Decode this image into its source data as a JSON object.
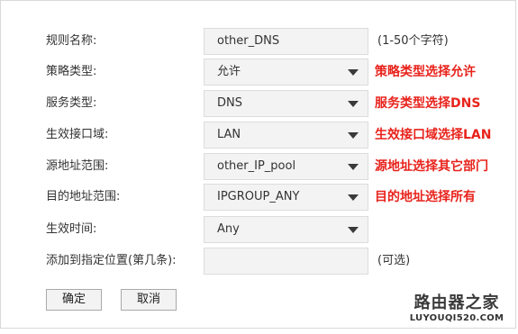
{
  "form": {
    "rows": [
      {
        "label": "规则名称:",
        "value": "other_DNS",
        "hint": "(1-50个字符)",
        "note": ""
      },
      {
        "label": "策略类型:",
        "value": "允许",
        "hint": "",
        "note": "策略类型选择允许"
      },
      {
        "label": "服务类型:",
        "value": "DNS",
        "hint": "",
        "note": "服务类型选择DNS"
      },
      {
        "label": "生效接口域:",
        "value": "LAN",
        "hint": "",
        "note": "生效接口域选择LAN"
      },
      {
        "label": "源地址范围:",
        "value": "other_IP_pool",
        "hint": "",
        "note": "源地址选择其它部门"
      },
      {
        "label": "目的地址范围:",
        "value": "IPGROUP_ANY",
        "hint": "",
        "note": "目的地址选择所有"
      },
      {
        "label": "生效时间:",
        "value": "Any",
        "hint": "",
        "note": ""
      },
      {
        "label": "添加到指定位置(第几条):",
        "value": "",
        "hint": "(可选)",
        "note": ""
      }
    ]
  },
  "buttons": {
    "confirm": "确定",
    "cancel": "取消"
  },
  "watermark": {
    "title": "路由器之家",
    "url": "LUYOUQI520.COM"
  },
  "colors": {
    "annotation": "#e8231c",
    "field_bg": "#f3f3f3"
  }
}
